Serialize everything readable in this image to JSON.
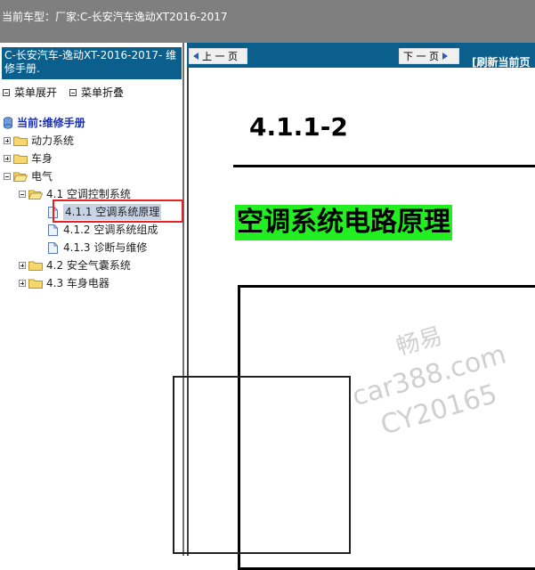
{
  "title_bar": {
    "label": "当前车型：",
    "value": "厂家:C-长安汽车逸动XT2016-2017"
  },
  "sidebar": {
    "header": "C-长安汽车-逸动XT-2016-2017- 维修手册.",
    "expand_all": "菜单展开",
    "collapse_all": "菜单折叠",
    "current": "当前:维修手册",
    "tree": [
      {
        "label": "动力系统",
        "type": "folder",
        "expanded": false
      },
      {
        "label": "车身",
        "type": "folder",
        "expanded": false
      },
      {
        "label": "电气",
        "type": "folder",
        "expanded": true
      },
      {
        "label": "4.1 空调控制系统",
        "type": "folder",
        "expanded": true
      },
      {
        "label": "4.1.1 空调系统原理",
        "type": "doc",
        "selected": true
      },
      {
        "label": "4.1.2 空调系统组成",
        "type": "doc"
      },
      {
        "label": "4.1.3 诊断与维修",
        "type": "doc"
      },
      {
        "label": "4.2 安全气囊系统",
        "type": "folder",
        "expanded": false
      },
      {
        "label": "4.3 车身电器",
        "type": "folder",
        "expanded": false
      }
    ]
  },
  "content": {
    "prev_button": "上 一 页",
    "next_button": "下 一 页",
    "refresh": "[刷新当前页",
    "section_number": "4.1.1-2",
    "section_title": "空调系统电路原理",
    "watermark": [
      "畅易",
      "car388.com",
      "CY20165"
    ]
  },
  "colors": {
    "title_bar": "#7f7f7f",
    "header_blue": "#0a5f8c",
    "title_highlight": "#22ee22",
    "annotation_red": "#e52222"
  }
}
